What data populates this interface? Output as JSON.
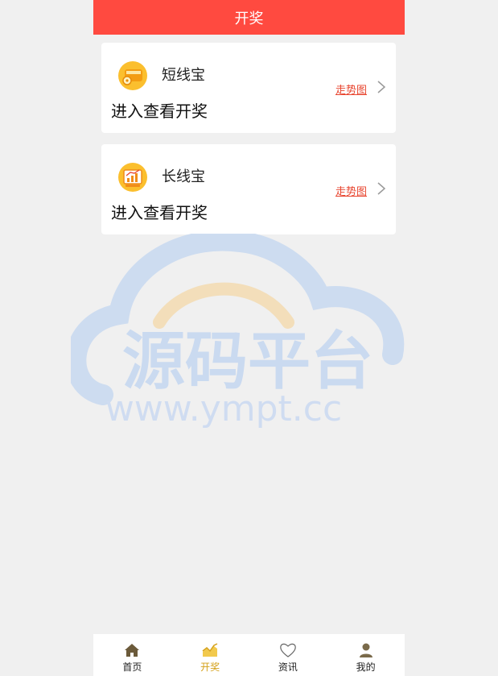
{
  "header": {
    "title": "开奖"
  },
  "cards": [
    {
      "name": "短线宝",
      "subtitle": "进入查看开奖",
      "trend_link": "走势图",
      "icon": "wallet-coin-icon"
    },
    {
      "name": "长线宝",
      "subtitle": "进入查看开奖",
      "trend_link": "走势图",
      "icon": "bar-chart-icon"
    }
  ],
  "watermark": {
    "text": "源码平台",
    "url": "www.ympt.cc"
  },
  "tabbar": {
    "items": [
      {
        "label": "首页",
        "icon": "home-icon",
        "active": false
      },
      {
        "label": "开奖",
        "icon": "trend-chart-icon",
        "active": true
      },
      {
        "label": "资讯",
        "icon": "heart-icon",
        "active": false
      },
      {
        "label": "我的",
        "icon": "user-icon",
        "active": false
      }
    ]
  },
  "colors": {
    "header_bg": "#ff4a40",
    "accent_link": "#e8452f",
    "active_tab": "#d4a018"
  }
}
